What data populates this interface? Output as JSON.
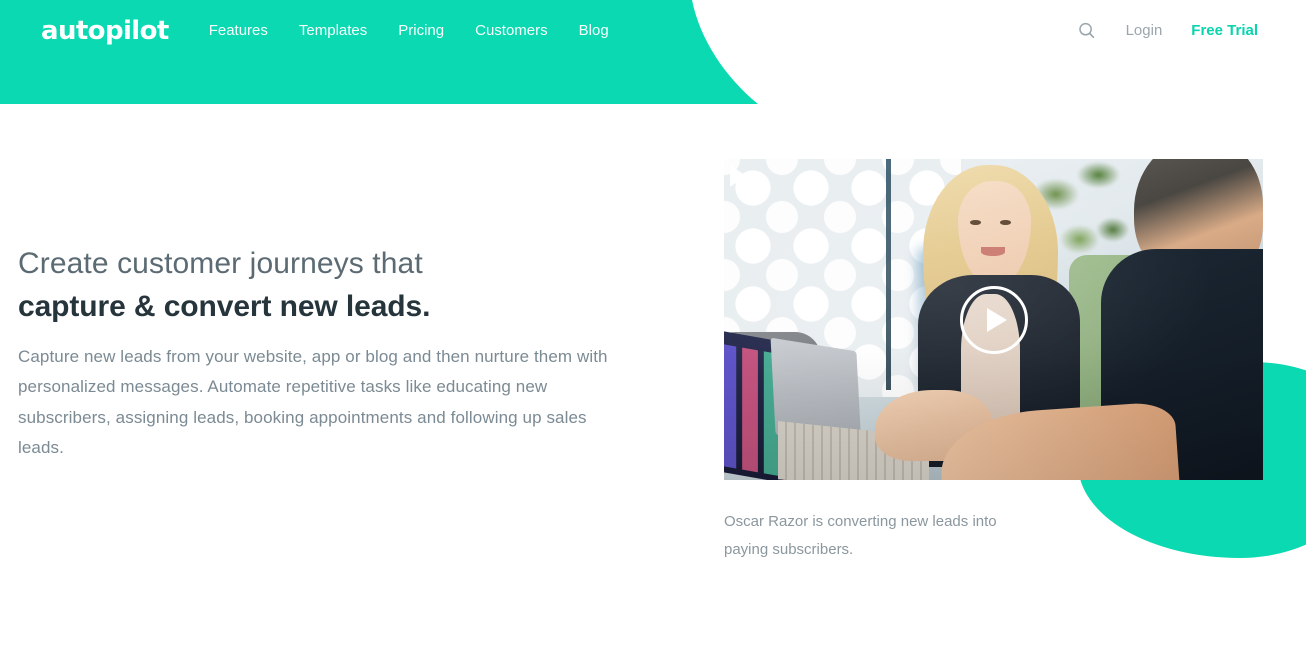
{
  "brand": {
    "logo_text": "autopilot",
    "teal": "#0ad9b1",
    "teal_link": "#0ad4ae",
    "headline_dark": "#26343c",
    "headline_light": "#5c6b73",
    "body_gray": "#7b8a93"
  },
  "header": {
    "nav": [
      {
        "label": "Features"
      },
      {
        "label": "Templates"
      },
      {
        "label": "Pricing"
      },
      {
        "label": "Customers"
      },
      {
        "label": "Blog"
      }
    ],
    "search_icon": "search-icon",
    "login_label": "Login",
    "free_trial_label": "Free Trial"
  },
  "hero": {
    "headline_line1": "Create customer journeys that",
    "headline_line2": "capture & convert new leads.",
    "body": "Capture new leads from your website, app or blog and then nurture them with personalized messages. Automate repetitive tasks like educating new subscribers, assigning leads, booking appointments and following up sales leads."
  },
  "video": {
    "play_icon": "play-icon",
    "corner_play_icon": "play-icon",
    "caption": "Oscar Razor is converting new leads into paying subscribers."
  }
}
